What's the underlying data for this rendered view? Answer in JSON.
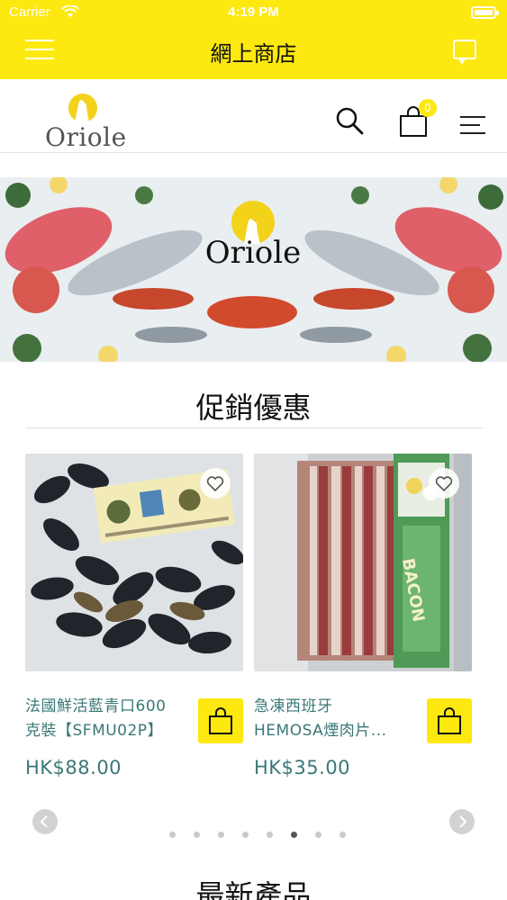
{
  "status_bar": {
    "carrier": "Carrier",
    "time": "4:19 PM"
  },
  "nav": {
    "title": "網上商店",
    "menu_icon": "hamburger-menu-icon",
    "chat_icon": "chat-bubble-icon"
  },
  "header": {
    "logo_text": "Oriole",
    "cart_count": "0"
  },
  "banner": {
    "logo_text": "Oriole"
  },
  "promotions": {
    "title": "促銷優惠",
    "products": [
      {
        "name_line1": "法國鮮活藍青口600",
        "name_line2": "克裝【SFMU02P】",
        "price": "HK$88.00"
      },
      {
        "name_line1": "急凍西班牙",
        "name_line2": "HEMOSA煙肉片...",
        "price": "HK$35.00"
      }
    ],
    "page_count": 8,
    "active_page": 6
  },
  "latest": {
    "title": "最新產品"
  },
  "colors": {
    "accent": "#fde810",
    "price": "#3a7877"
  }
}
